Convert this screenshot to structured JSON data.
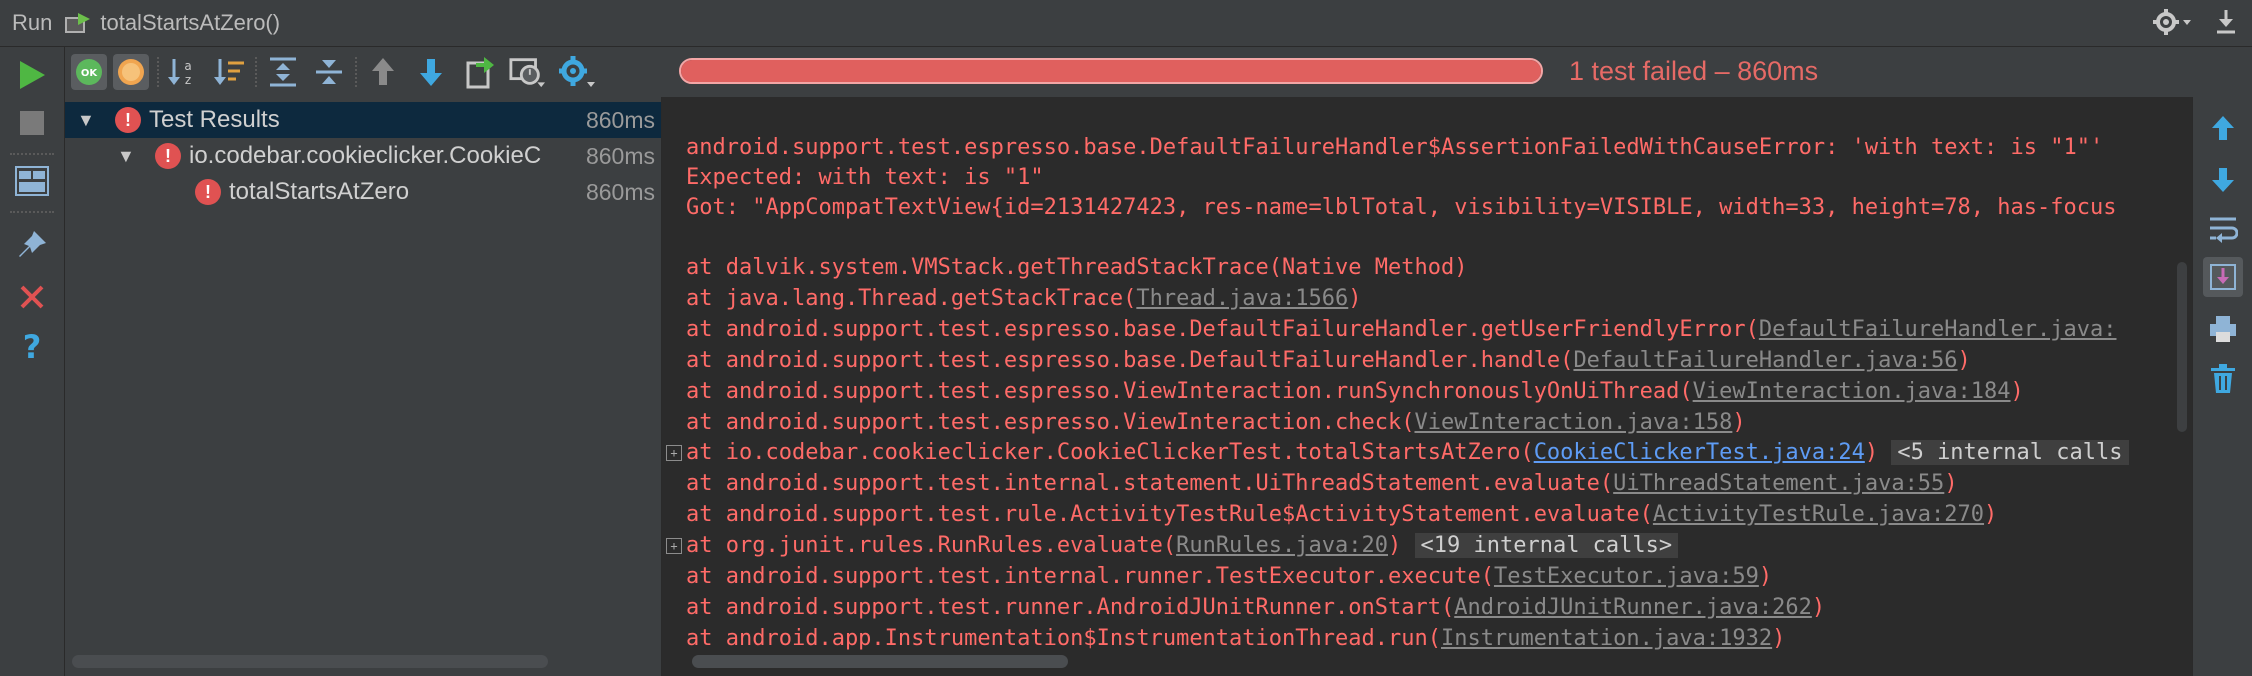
{
  "window": {
    "run_label": "Run",
    "config_name": "totalStartsAtZero()",
    "icons": [
      "run-config-icon",
      "gear-icon",
      "minimize-icon"
    ]
  },
  "toolbar": {
    "left": [
      "run-icon",
      "stop-icon",
      "layout-icon",
      "pin-icon",
      "close-icon",
      "help-icon"
    ],
    "top": [
      "show-passed-icon",
      "show-ignored-icon",
      "sort-alpha-icon",
      "sort-duration-icon",
      "expand-all-icon",
      "collapse-all-icon",
      "previous-failed-icon",
      "next-failed-icon",
      "export-icon",
      "import-history-icon",
      "settings-icon"
    ],
    "right": [
      "up-arrow-icon",
      "down-arrow-icon",
      "soft-wrap-icon",
      "scroll-to-end-icon",
      "print-icon",
      "trash-icon"
    ]
  },
  "progress": {
    "fraction": 1.0,
    "status": "1 test failed",
    "separator": " – ",
    "time": "860ms"
  },
  "tree": {
    "rows": [
      {
        "label": "Test Results",
        "time": "860ms",
        "selected": true
      },
      {
        "label": "io.codebar.cookieclicker.CookieC",
        "time": "860ms"
      },
      {
        "label": "totalStartsAtZero",
        "time": "860ms"
      }
    ]
  },
  "console": {
    "header": [
      "android.support.test.espresso.base.DefaultFailureHandler$AssertionFailedWithCauseError: 'with text: is \"1\"'",
      "Expected: with text: is \"1\"",
      "Got: \"AppCompatTextView{id=2131427423, res-name=lblTotal, visibility=VISIBLE, width=33, height=78, has-focus"
    ],
    "frames": [
      {
        "prefix": "at dalvik.system.VMStack.getThreadStackTrace(Native Method)",
        "link": "",
        "suffix": "",
        "internal": ""
      },
      {
        "prefix": "at java.lang.Thread.getStackTrace(",
        "link": "Thread.java:1566",
        "suffix": ")",
        "internal": ""
      },
      {
        "prefix": "at android.support.test.espresso.base.DefaultFailureHandler.getUserFriendlyError(",
        "link": "DefaultFailureHandler.java:",
        "suffix": "",
        "internal": ""
      },
      {
        "prefix": "at android.support.test.espresso.base.DefaultFailureHandler.handle(",
        "link": "DefaultFailureHandler.java:56",
        "suffix": ")",
        "internal": ""
      },
      {
        "prefix": "at android.support.test.espresso.ViewInteraction.runSynchronouslyOnUiThread(",
        "link": "ViewInteraction.java:184",
        "suffix": ")",
        "internal": ""
      },
      {
        "prefix": "at android.support.test.espresso.ViewInteraction.check(",
        "link": "ViewInteraction.java:158",
        "suffix": ")",
        "internal": ""
      },
      {
        "prefix": "at io.codebar.cookieclicker.CookieClickerTest.totalStartsAtZero(",
        "link": "CookieClickerTest.java:24",
        "suffix": ")",
        "internal": "<5 internal calls"
      },
      {
        "prefix": "at android.support.test.internal.statement.UiThreadStatement.evaluate(",
        "link": "UiThreadStatement.java:55",
        "suffix": ")",
        "internal": ""
      },
      {
        "prefix": "at android.support.test.rule.ActivityTestRule$ActivityStatement.evaluate(",
        "link": "ActivityTestRule.java:270",
        "suffix": ")",
        "internal": ""
      },
      {
        "prefix": "at org.junit.rules.RunRules.evaluate(",
        "link": "RunRules.java:20",
        "suffix": ")",
        "internal": "<19 internal calls>"
      },
      {
        "prefix": "at android.support.test.internal.runner.TestExecutor.execute(",
        "link": "TestExecutor.java:59",
        "suffix": ")",
        "internal": ""
      },
      {
        "prefix": "at android.support.test.runner.AndroidJUnitRunner.onStart(",
        "link": "AndroidJUnitRunner.java:262",
        "suffix": ")",
        "internal": ""
      },
      {
        "prefix": "at android.app.Instrumentation$InstrumentationThread.run(",
        "link": "Instrumentation.java:1932",
        "suffix": ")",
        "internal": ""
      }
    ],
    "fold_marker": "+"
  },
  "colors": {
    "error": "#ff6b68",
    "link": "#8a8a8a",
    "link_active": "#5e9cf5",
    "progress": "#de5b5b",
    "run_green": "#4fb743"
  }
}
